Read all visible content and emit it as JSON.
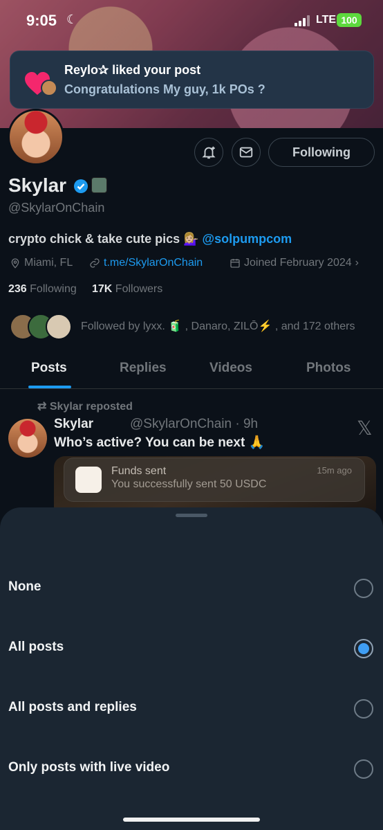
{
  "status_bar": {
    "time": "9:05",
    "network": "LTE",
    "battery": "100"
  },
  "notification": {
    "title": "Reylo✰ liked your post",
    "body": "Congratulations My guy, 1k POs ?"
  },
  "profile": {
    "following_button": "Following",
    "display_name": "Skylar",
    "handle": "@SkylarOnChain",
    "bio_text": "crypto chick & take cute pics 💁🏼‍♀️ ",
    "bio_mention": "@solpumpcom",
    "location": "Miami, FL",
    "link": "t.me/SkylarOnChain",
    "joined": "Joined February 2024",
    "following_count": "236",
    "following_label": "Following",
    "followers_count": "17K",
    "followers_label": "Followers",
    "followed_by": "Followed by lyxx. 🧃 , Danaro, ZILŌ⚡ , and 172 others"
  },
  "tabs": [
    "Posts",
    "Replies",
    "Videos",
    "Photos"
  ],
  "post": {
    "repost_label": "Skylar reposted",
    "author_name": "Skylar",
    "author_handle_time": "@SkylarOnChain · 9h",
    "text": "Who’s active? You can be next 🙏",
    "media_notification": {
      "title": "Funds sent",
      "body": "You successfully sent 50 USDC",
      "time": "15m ago"
    }
  },
  "sheet": {
    "options": [
      {
        "label": "None",
        "selected": false
      },
      {
        "label": "All posts",
        "selected": true
      },
      {
        "label": "All posts and replies",
        "selected": false
      },
      {
        "label": "Only posts with live video",
        "selected": false
      }
    ]
  },
  "colors": {
    "accent": "#1d9bf0",
    "sheet": "#1b2632",
    "background": "#0b1119"
  },
  "icons": [
    "moon-icon",
    "heart-icon",
    "bell-plus-icon",
    "mail-icon",
    "verified-badge-icon",
    "location-icon",
    "link-icon",
    "calendar-icon",
    "chevron-right-icon",
    "repost-icon",
    "x-logo-icon",
    "metamask-icon"
  ]
}
